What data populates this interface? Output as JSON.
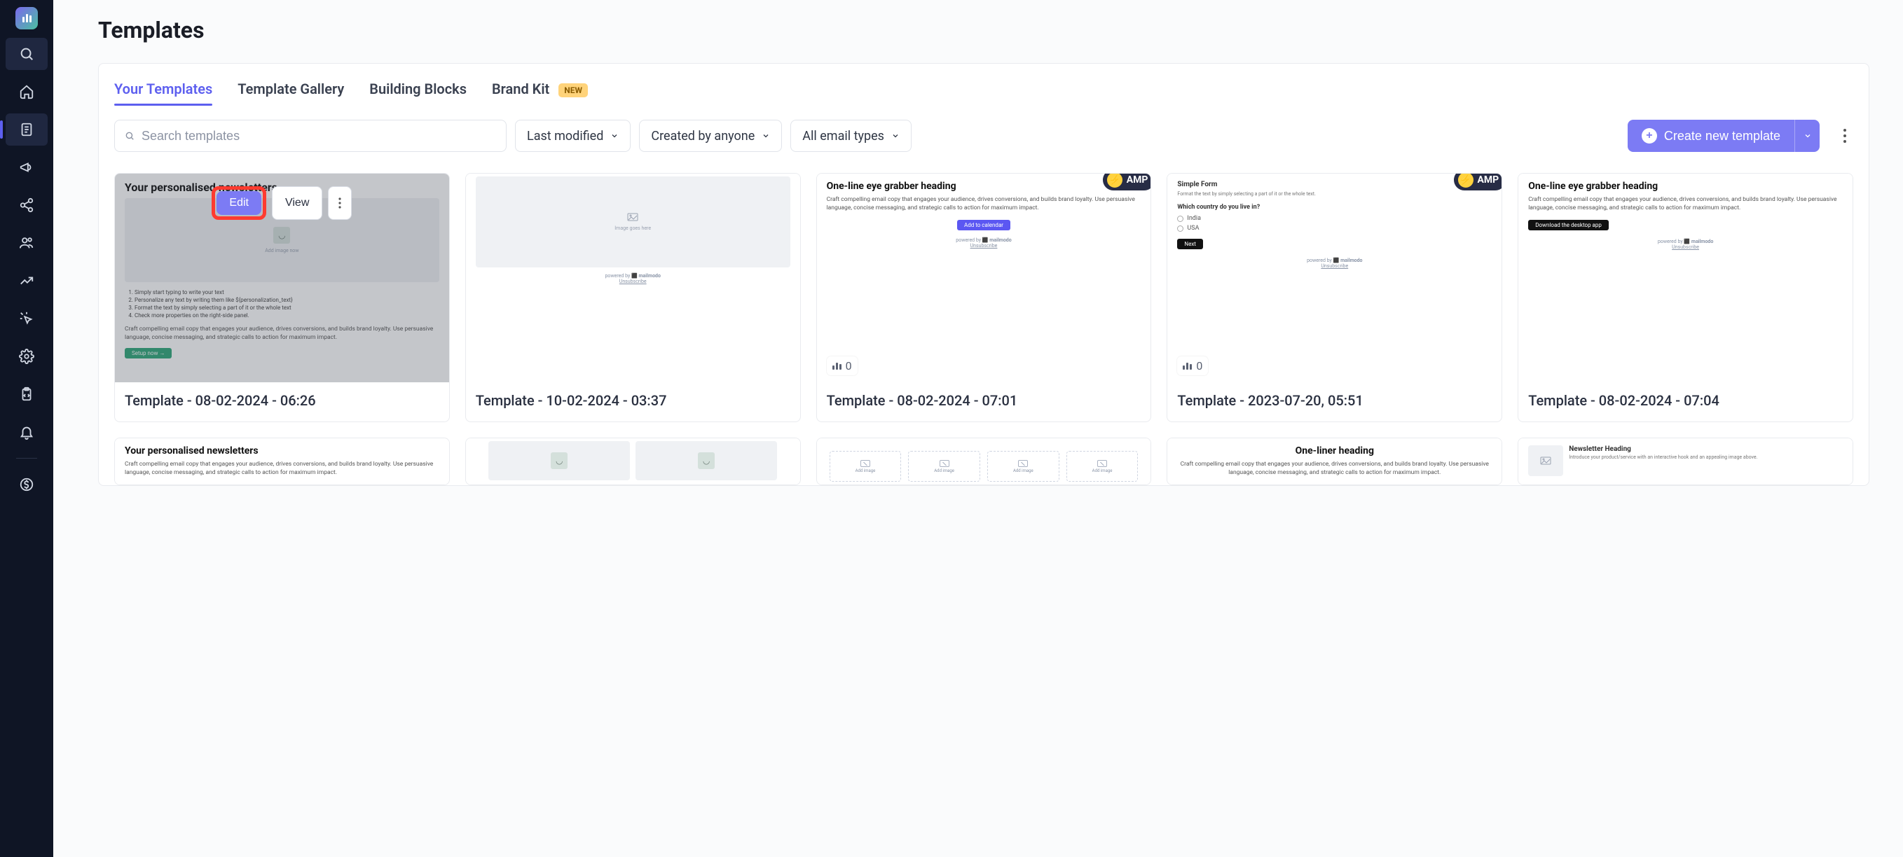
{
  "page": {
    "title": "Templates"
  },
  "tabs": {
    "your": "Your Templates",
    "gallery": "Template Gallery",
    "blocks": "Building Blocks",
    "brand": "Brand Kit",
    "brand_badge": "NEW"
  },
  "filters": {
    "search_placeholder": "Search templates",
    "last_modified": "Last modified",
    "created_by": "Created by anyone",
    "email_types": "All email types"
  },
  "actions": {
    "create": "Create new template",
    "edit": "Edit",
    "view": "View"
  },
  "amp_label": "AMP",
  "cards": [
    {
      "title": "Template - 08-02-2024 - 06:26"
    },
    {
      "title": "Template - 10-02-2024 - 03:37"
    },
    {
      "title": "Template - 08-02-2024 - 07:01",
      "uses": 0
    },
    {
      "title": "Template - 2023-07-20, 05:51",
      "uses": 0
    },
    {
      "title": "Template - 08-02-2024 - 07:04"
    }
  ],
  "mock": {
    "newsletter_heading": "Your personalised newsletters",
    "copy": "Craft compelling email copy that engages your audience, drives conversions, and builds brand loyalty. Use persuasive language, concise messaging, and strategic calls to action for maximum impact.",
    "image_goes_here": "Image goes here",
    "add_image_now": "Add image now",
    "list": [
      "Simply start typing to write your text",
      "Personalize any text by writing them like ${personalization_text}",
      "Format the text by simply selecting a part of it or the whole text",
      "Check more properties on the right-side panel."
    ],
    "one_line": "One-line eye grabber heading",
    "add_to_cal": "Add to calendar",
    "powered": "powered by",
    "brand": "mailmodo",
    "unsubscribe": "Unsubscribe",
    "simple_form": "Simple Form",
    "form_hint": "Format the text by simply selecting a part of it or the whole text.",
    "q_country": "Which country do you live in?",
    "opt_india": "India",
    "opt_usa": "USA",
    "next": "Next",
    "download": "Download the desktop app",
    "one_liner": "One-liner heading",
    "newsletter_heading2": "Newsletter Heading",
    "intro": "Introduce your product/service with an interactive hook and an appealing image above.",
    "add_image": "Add image",
    "setup_now": "Setup now  →"
  }
}
